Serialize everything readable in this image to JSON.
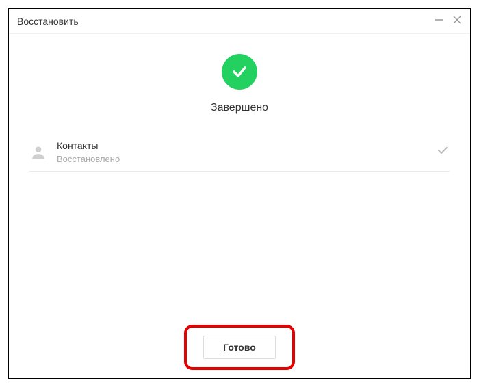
{
  "window": {
    "title": "Восстановить"
  },
  "status": {
    "title": "Завершено"
  },
  "items": [
    {
      "name": "Контакты",
      "status": "Восстановлено"
    }
  ],
  "footer": {
    "done_label": "Готово"
  },
  "colors": {
    "success": "#23d160",
    "highlight": "#e60000"
  }
}
